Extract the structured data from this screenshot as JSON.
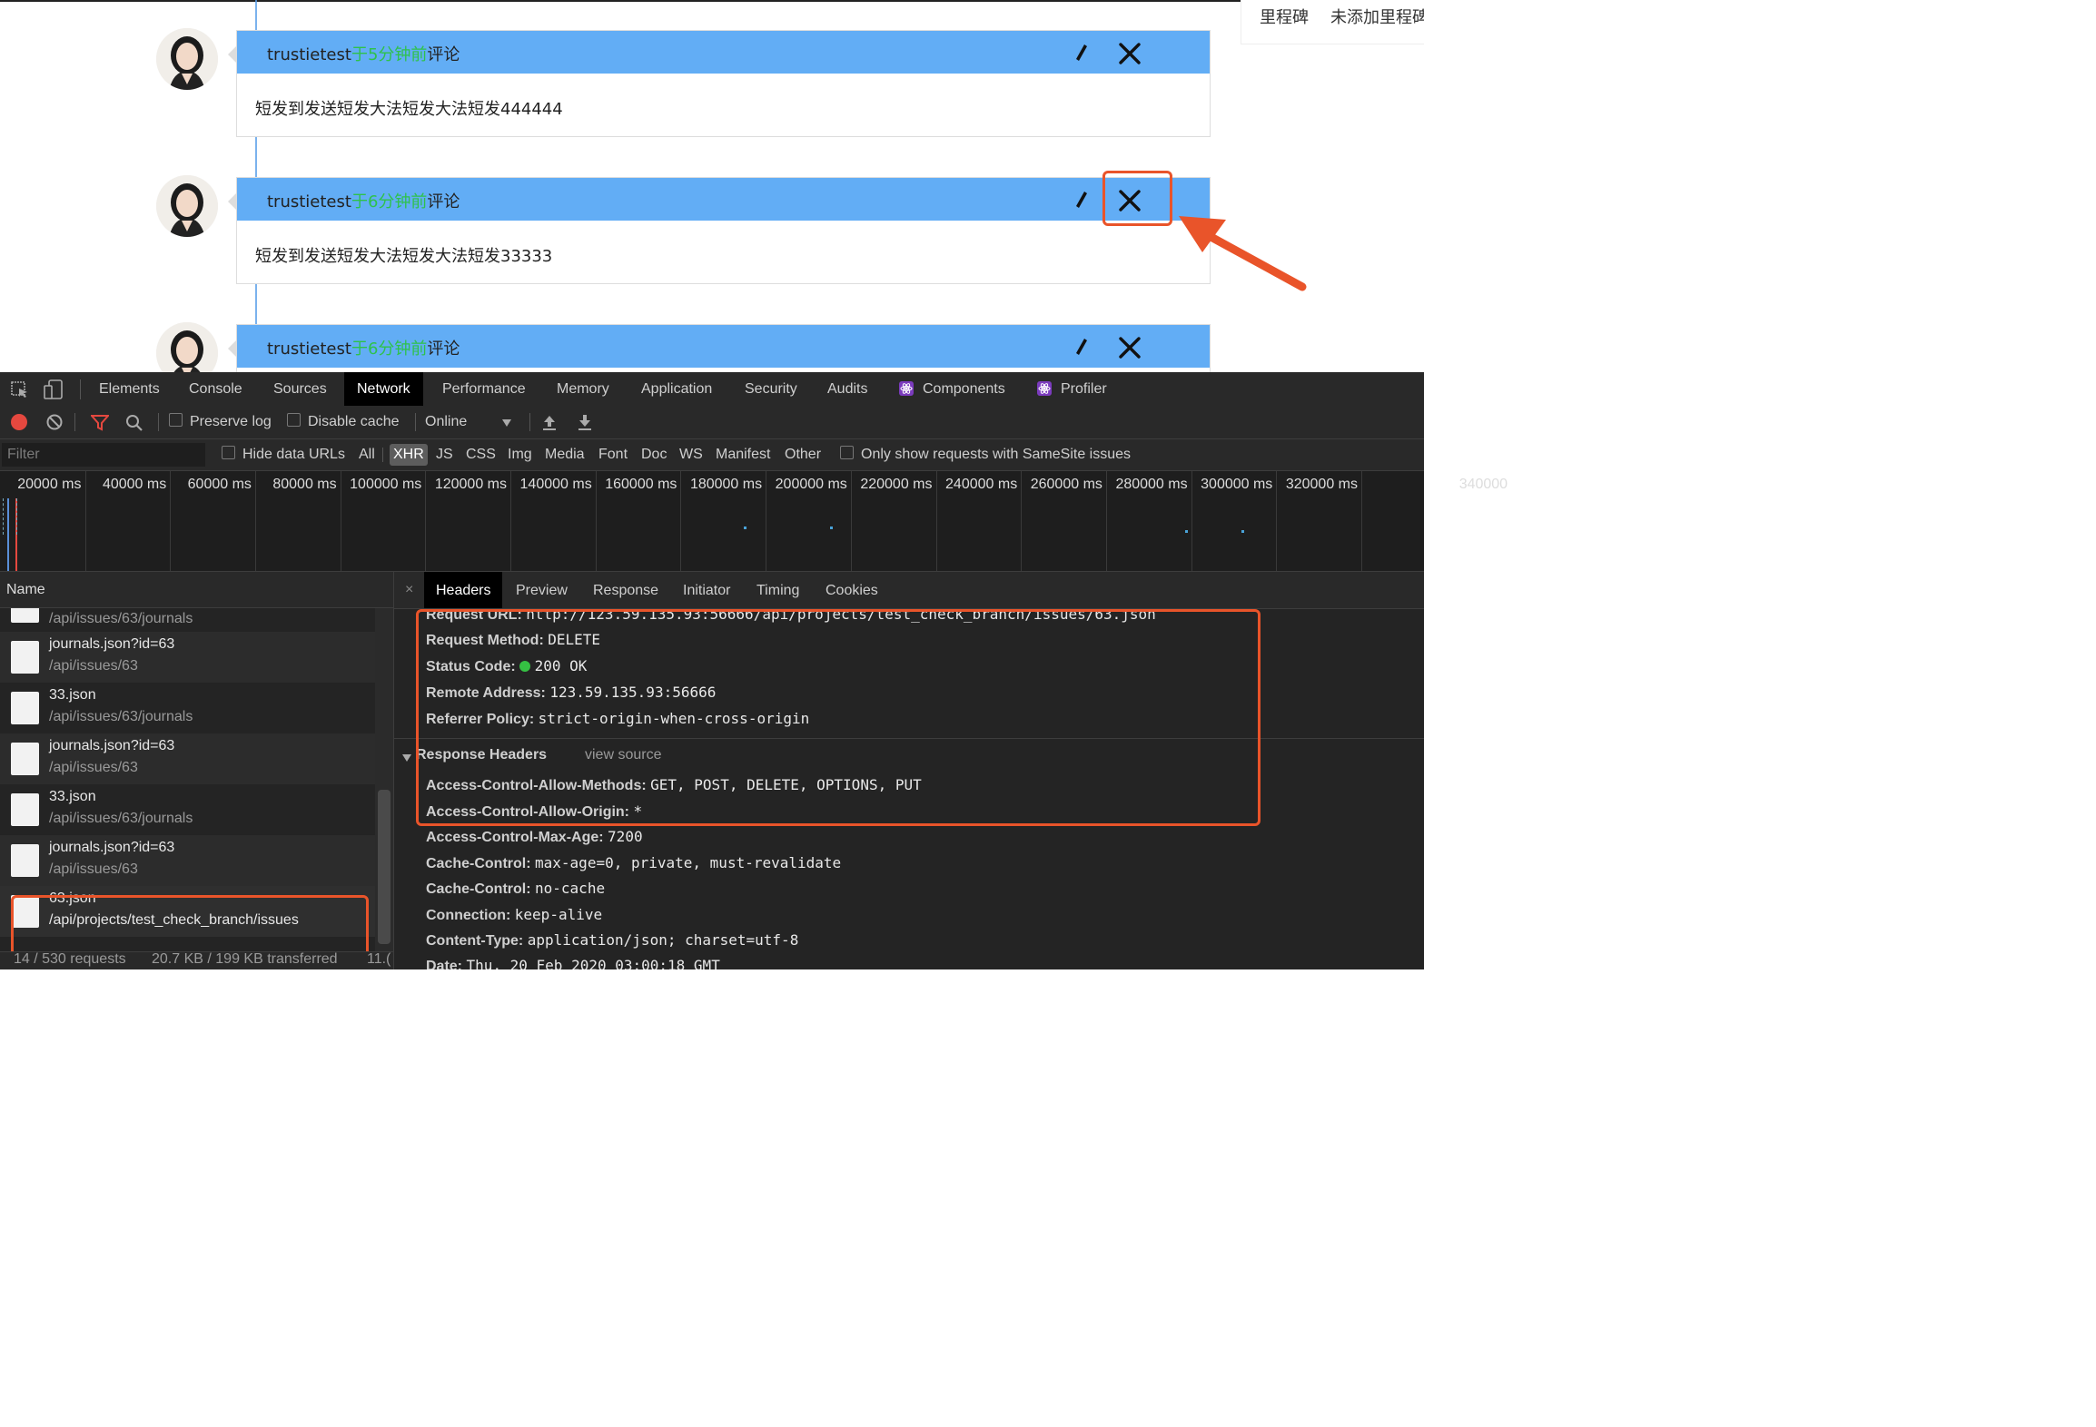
{
  "page": {
    "milestone": {
      "label": "里程碑",
      "value": "未添加里程碑"
    },
    "comments": [
      {
        "user": "trustietest",
        "time": "于5分钟前",
        "action": "评论",
        "body": "短发到发送短发大法短发大法短发444444"
      },
      {
        "user": "trustietest",
        "time": "于6分钟前",
        "action": "评论",
        "body": "短发到发送短发大法短发大法短发33333"
      },
      {
        "user": "trustietest",
        "time": "于6分钟前",
        "action": "评论",
        "body": ""
      }
    ]
  },
  "devtools": {
    "tabs": [
      "Elements",
      "Console",
      "Sources",
      "Network",
      "Performance",
      "Memory",
      "Application",
      "Security",
      "Audits",
      "Components",
      "Profiler"
    ],
    "active_tab": "Network",
    "toolbar": {
      "preserve_log": "Preserve log",
      "disable_cache": "Disable cache",
      "throttle": "Online"
    },
    "filter": {
      "placeholder": "Filter",
      "hide_data_urls": "Hide data URLs",
      "types": [
        "All",
        "XHR",
        "JS",
        "CSS",
        "Img",
        "Media",
        "Font",
        "Doc",
        "WS",
        "Manifest",
        "Other"
      ],
      "active_type": "XHR",
      "samesite": "Only show requests with SameSite issues"
    },
    "timeline_ticks": [
      "20000 ms",
      "40000 ms",
      "60000 ms",
      "80000 ms",
      "100000 ms",
      "120000 ms",
      "140000 ms",
      "160000 ms",
      "180000 ms",
      "200000 ms",
      "220000 ms",
      "240000 ms",
      "260000 ms",
      "280000 ms",
      "300000 ms",
      "320000 ms",
      "340000"
    ],
    "name_header": "Name",
    "requests": [
      {
        "name": "",
        "path": "/api/issues/63/journals"
      },
      {
        "name": "journals.json?id=63",
        "path": "/api/issues/63"
      },
      {
        "name": "33.json",
        "path": "/api/issues/63/journals"
      },
      {
        "name": "journals.json?id=63",
        "path": "/api/issues/63"
      },
      {
        "name": "33.json",
        "path": "/api/issues/63/journals"
      },
      {
        "name": "journals.json?id=63",
        "path": "/api/issues/63"
      },
      {
        "name": "63.json",
        "path": "/api/projects/test_check_branch/issues"
      }
    ],
    "status_bar": {
      "requests": "14 / 530 requests",
      "transferred": "20.7 KB / 199 KB transferred",
      "extra": "11.("
    },
    "detail_tabs": [
      "Headers",
      "Preview",
      "Response",
      "Initiator",
      "Timing",
      "Cookies"
    ],
    "active_detail_tab": "Headers",
    "general": [
      {
        "key": "Request URL:",
        "value": "http://123.59.135.93:56666/api/projects/test_check_branch/issues/63.json"
      },
      {
        "key": "Request Method:",
        "value": "DELETE"
      },
      {
        "key": "Status Code:",
        "value": "200 OK"
      },
      {
        "key": "Remote Address:",
        "value": "123.59.135.93:56666"
      },
      {
        "key": "Referrer Policy:",
        "value": "strict-origin-when-cross-origin"
      }
    ],
    "response_headers_title": "Response Headers",
    "view_source": "view source",
    "response_headers": [
      {
        "key": "Access-Control-Allow-Methods:",
        "value": "GET, POST, DELETE, OPTIONS, PUT"
      },
      {
        "key": "Access-Control-Allow-Origin:",
        "value": "*"
      },
      {
        "key": "Access-Control-Max-Age:",
        "value": "7200"
      },
      {
        "key": "Cache-Control:",
        "value": "max-age=0, private, must-revalidate"
      },
      {
        "key": "Cache-Control:",
        "value": "no-cache"
      },
      {
        "key": "Connection:",
        "value": "keep-alive"
      },
      {
        "key": "Content-Type:",
        "value": "application/json; charset=utf-8"
      },
      {
        "key": "Date:",
        "value": "Thu, 20 Feb 2020 03:00:18 GMT"
      }
    ]
  },
  "colors": {
    "header_blue": "#62adf5",
    "time_green": "#2ec24b",
    "highlight_red": "#e9542a",
    "status_green": "#35c043"
  }
}
